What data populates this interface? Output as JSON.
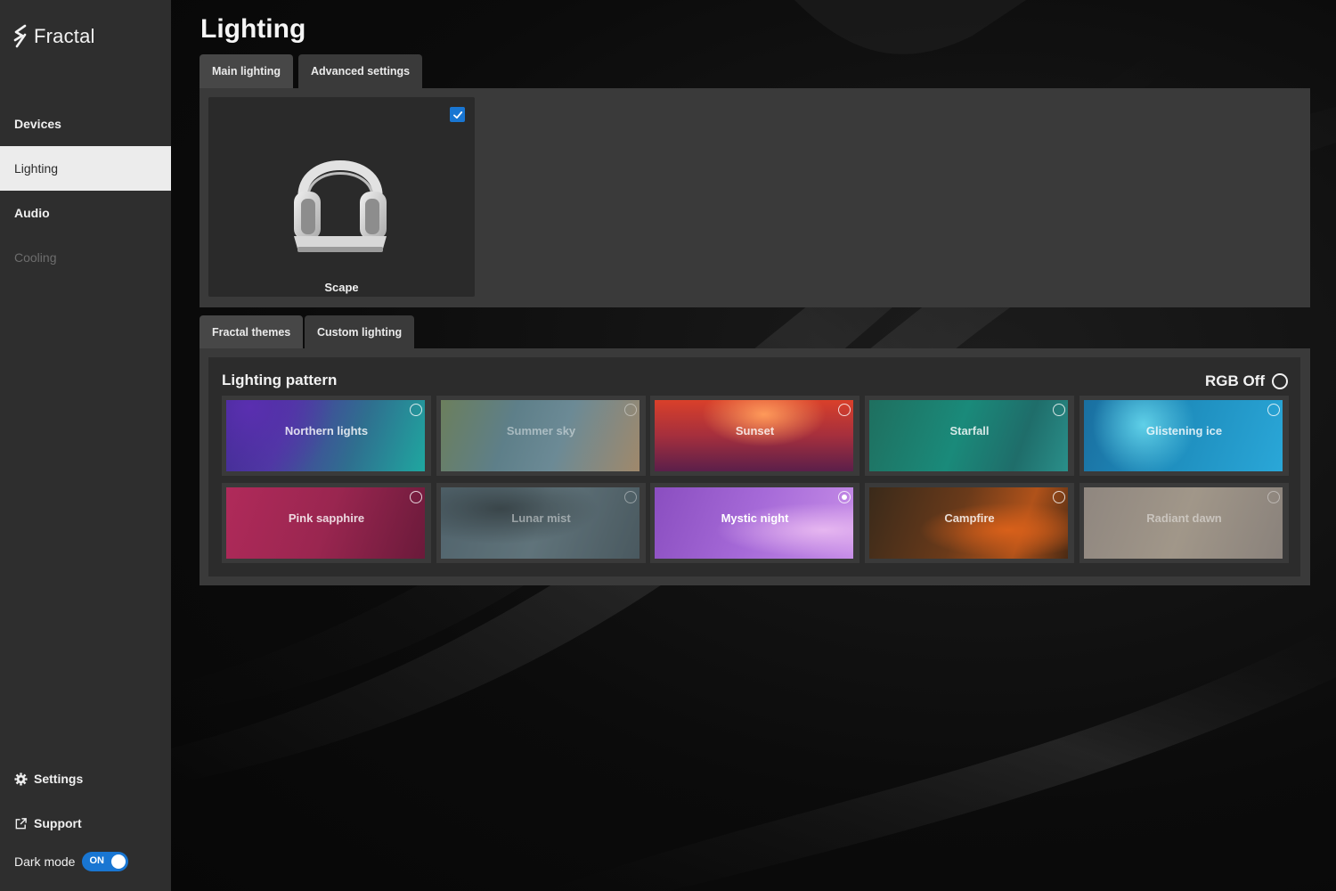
{
  "app": {
    "logo_text": "Fractal"
  },
  "sidebar": {
    "items": [
      {
        "label": "Devices"
      },
      {
        "label": "Lighting"
      },
      {
        "label": "Audio"
      },
      {
        "label": "Cooling"
      }
    ],
    "settings_label": "Settings",
    "support_label": "Support",
    "dark_mode_label": "Dark mode",
    "dark_mode_state": "ON"
  },
  "page": {
    "title": "Lighting"
  },
  "top_tabs": [
    {
      "label": "Main lighting"
    },
    {
      "label": "Advanced settings"
    }
  ],
  "device": {
    "name": "Scape",
    "checked": true
  },
  "lighting_tabs": [
    {
      "label": "Fractal themes"
    },
    {
      "label": "Custom lighting"
    }
  ],
  "pattern": {
    "title": "Lighting pattern",
    "rgb_off_label": "RGB Off",
    "themes": [
      {
        "name": "Northern lights"
      },
      {
        "name": "Summer sky"
      },
      {
        "name": "Sunset"
      },
      {
        "name": "Starfall"
      },
      {
        "name": "Glistening ice"
      },
      {
        "name": "Pink sapphire"
      },
      {
        "name": "Lunar mist"
      },
      {
        "name": "Mystic night",
        "selected": true
      },
      {
        "name": "Campfire"
      },
      {
        "name": "Radiant dawn"
      }
    ]
  },
  "colors": {
    "accent": "#1976d2",
    "sidebar_bg": "#2e2e2e",
    "panel_bg": "#3a3a3a"
  }
}
